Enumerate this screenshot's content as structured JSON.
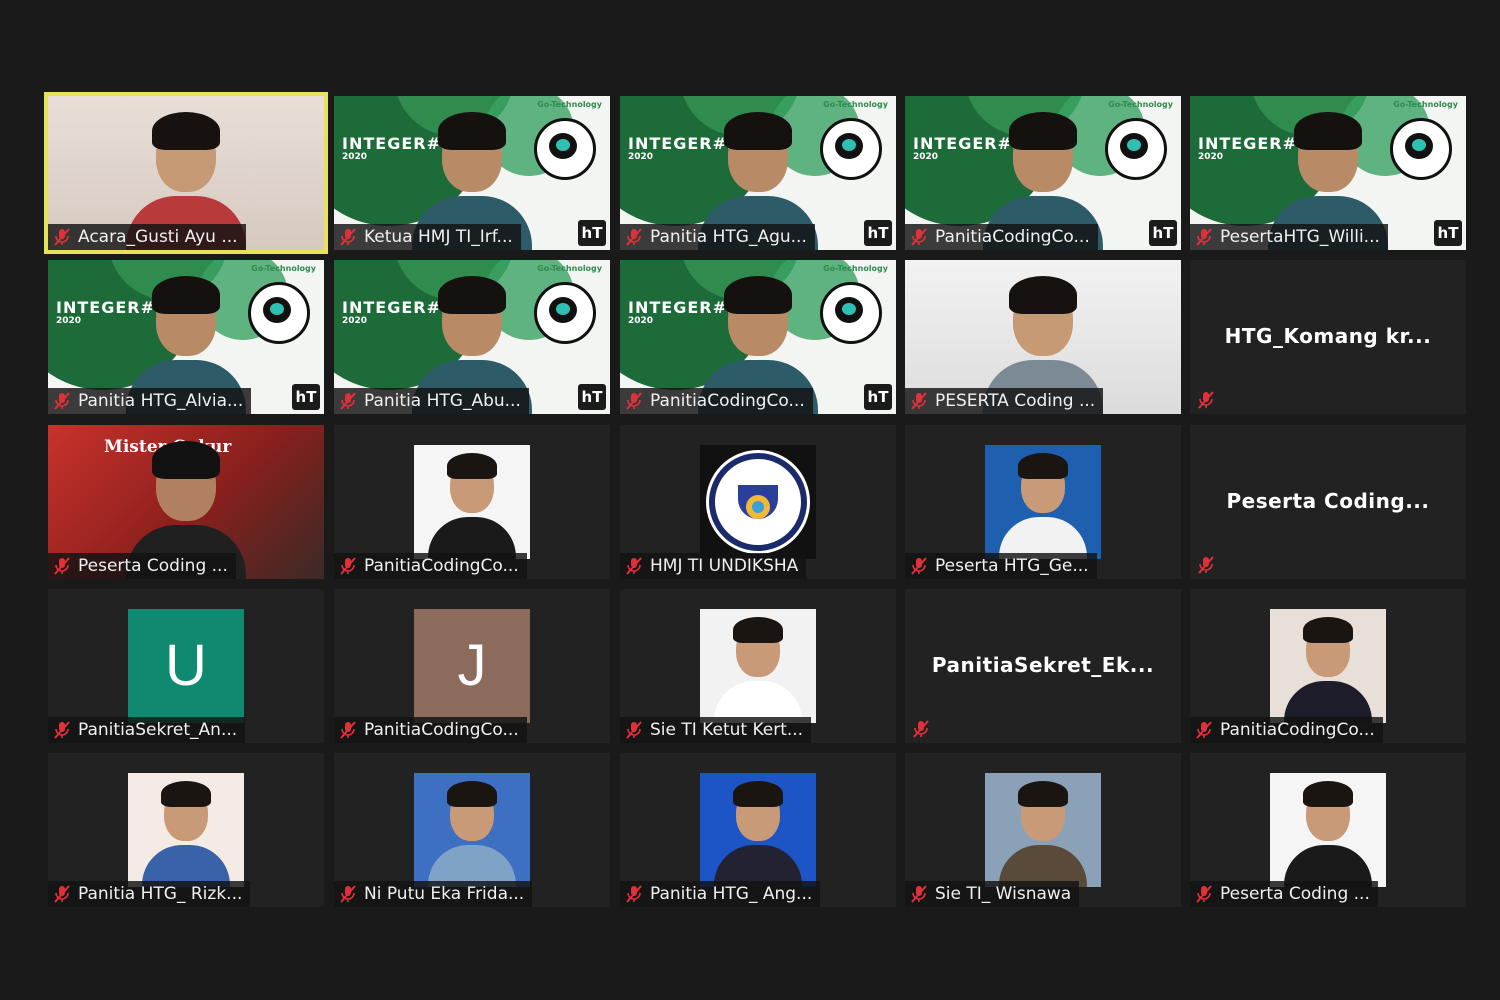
{
  "colors": {
    "background": "#1a1a1a",
    "tile": "#222222",
    "active_speaker_border": "#e9e15a",
    "muted_mic": "#e0313a"
  },
  "banner": {
    "title": "INTEGER#2",
    "year": "2020",
    "brand": "Go-Technology",
    "logo": "hT"
  },
  "tiles": [
    {
      "label": "Acara_Gusti Ayu ...",
      "kind": "video",
      "active": true,
      "muted": true
    },
    {
      "label": "Ketua HMJ TI_Irf...",
      "kind": "video-banner",
      "muted": true
    },
    {
      "label": "Panitia HTG_Agu...",
      "kind": "video-banner",
      "muted": true
    },
    {
      "label": "PanitiaCodingCo...",
      "kind": "video-banner",
      "muted": true
    },
    {
      "label": "PesertaHTG_Willi...",
      "kind": "video-banner",
      "muted": true
    },
    {
      "label": "Panitia HTG_Alvia...",
      "kind": "video-banner",
      "muted": true
    },
    {
      "label": "Panitia HTG_Abu...",
      "kind": "video-banner",
      "muted": true
    },
    {
      "label": "PanitiaCodingCo...",
      "kind": "video-banner",
      "muted": true
    },
    {
      "label": "PESERTA Coding ...",
      "kind": "video",
      "muted": true
    },
    {
      "label": "HTG_Komang  kr...",
      "kind": "name-only",
      "muted": true
    },
    {
      "label": "Peserta Coding ...",
      "kind": "video-red",
      "muted": true,
      "background_text": "Mister Cukur"
    },
    {
      "label": "PanitiaCodingCo...",
      "kind": "photo",
      "muted": true
    },
    {
      "label": "HMJ TI UNDIKSHA",
      "kind": "logo-photo",
      "muted": true
    },
    {
      "label": "Peserta HTG_Ge...",
      "kind": "photo",
      "muted": true
    },
    {
      "label": "Peserta  Coding...",
      "kind": "name-only",
      "muted": true
    },
    {
      "label": "PanitiaSekret_An...",
      "kind": "letter",
      "letter": "U",
      "letter_color": "#0f8a70",
      "muted": true
    },
    {
      "label": "PanitiaCodingCo...",
      "kind": "letter",
      "letter": "J",
      "letter_color": "#8c6a5c",
      "muted": true
    },
    {
      "label": "Sie TI Ketut Kert...",
      "kind": "photo",
      "muted": true
    },
    {
      "label": "PanitiaSekret_Ek...",
      "kind": "name-only",
      "muted": true
    },
    {
      "label": "PanitiaCodingCo...",
      "kind": "photo",
      "muted": true
    },
    {
      "label": "Panitia HTG_ Rizk...",
      "kind": "photo",
      "muted": true
    },
    {
      "label": "Ni Putu Eka Frida...",
      "kind": "photo",
      "muted": true
    },
    {
      "label": "Panitia HTG_ Ang...",
      "kind": "photo",
      "muted": true
    },
    {
      "label": "Sie TI_ Wisnawa",
      "kind": "photo",
      "muted": true
    },
    {
      "label": "Peserta Coding ...",
      "kind": "photo",
      "muted": true
    }
  ]
}
